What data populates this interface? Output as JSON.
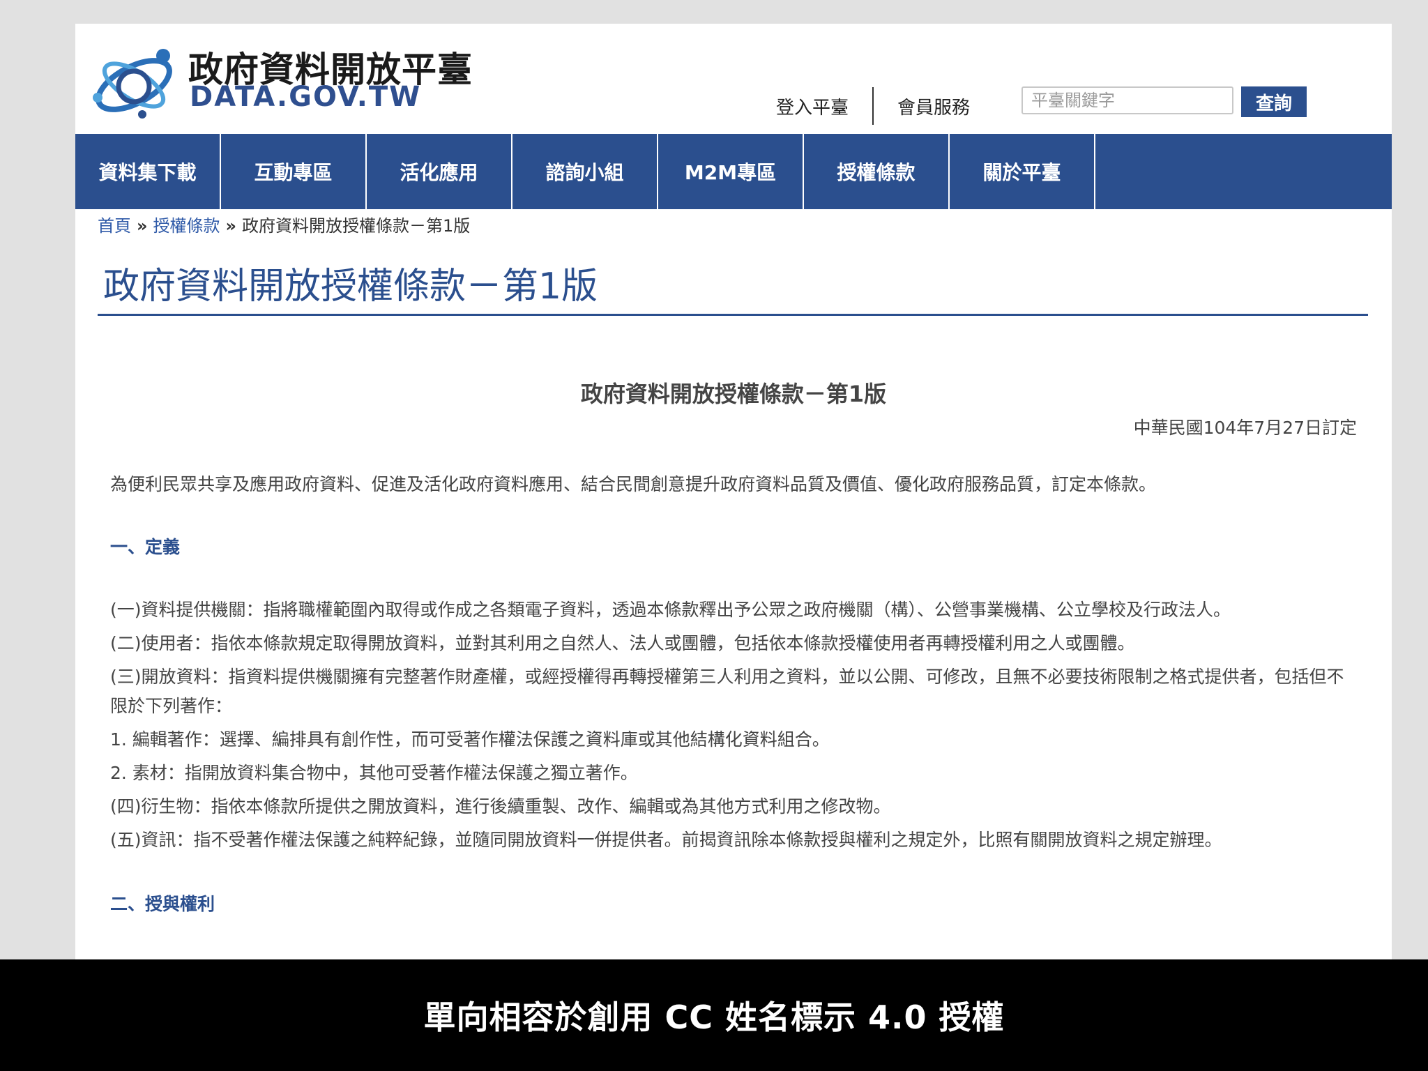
{
  "header": {
    "logo_title": "政府資料開放平臺",
    "logo_subtitle": "DATA.GOV.TW",
    "login_link": "登入平臺",
    "member_link": "會員服務",
    "search_placeholder": "平臺關鍵字",
    "search_button": "查詢"
  },
  "nav": {
    "items": [
      "資料集下載",
      "互動專區",
      "活化應用",
      "諮詢小組",
      "M2M專區",
      "授權條款",
      "關於平臺"
    ]
  },
  "breadcrumb": {
    "home": "首頁",
    "sep": "»",
    "parent": "授權條款",
    "current": "政府資料開放授權條款－第1版"
  },
  "page_title": "政府資料開放授權條款－第1版",
  "document": {
    "title": "政府資料開放授權條款－第1版",
    "date": "中華民國104年7月27日訂定",
    "intro": "為便利民眾共享及應用政府資料、促進及活化政府資料應用、結合民間創意提升政府資料品質及價值、優化政府服務品質，訂定本條款。",
    "section1_heading": "一、定義",
    "definitions": [
      "(一)資料提供機關：指將職權範圍內取得或作成之各類電子資料，透過本條款釋出予公眾之政府機關（構）、公營事業機構、公立學校及行政法人。",
      "(二)使用者：指依本條款規定取得開放資料，並對其利用之自然人、法人或團體，包括依本條款授權使用者再轉授權利用之人或團體。",
      "(三)開放資料：指資料提供機關擁有完整著作財產權，或經授權得再轉授權第三人利用之資料，並以公開、可修改，且無不必要技術限制之格式提供者，包括但不限於下列著作：",
      "1. 編輯著作：選擇、編排具有創作性，而可受著作權法保護之資料庫或其他結構化資料組合。",
      "2. 素材：指開放資料集合物中，其他可受著作權法保護之獨立著作。",
      "(四)衍生物：指依本條款所提供之開放資料，進行後續重製、改作、編輯或為其他方式利用之修改物。",
      "(五)資訊：指不受著作權法保護之純粹紀錄，並隨同開放資料一併提供者。前揭資訊除本條款授與權利之規定外，比照有關開放資料之規定辦理。"
    ],
    "section2_heading": "二、授與權利"
  },
  "caption": "單向相容於創用 CC 姓名標示 4.0 授權",
  "colors": {
    "brand_blue": "#2b4f8e",
    "link_blue": "#2f5aa8",
    "backdrop": "#e1e1e1"
  }
}
